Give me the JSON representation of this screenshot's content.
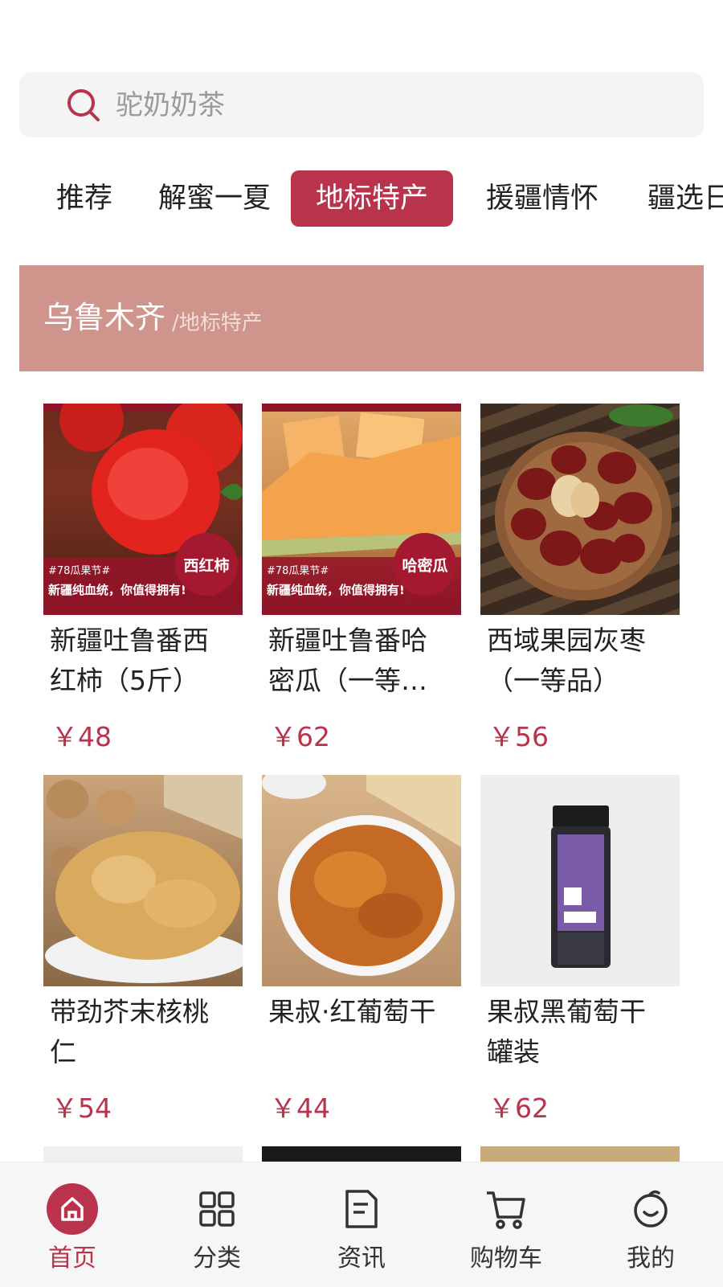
{
  "search": {
    "placeholder": "驼奶奶茶"
  },
  "tabs": [
    {
      "label": "推荐",
      "active": false
    },
    {
      "label": "解蜜一夏",
      "active": false
    },
    {
      "label": "地标特产",
      "active": true
    },
    {
      "label": "援疆情怀",
      "active": false
    },
    {
      "label": "疆选日",
      "active": false
    }
  ],
  "banner": {
    "title": "乌鲁木齐",
    "subtitle": "/地标特产"
  },
  "products": [
    {
      "title": "新疆吐鲁番西红柿（5斤）",
      "price": "￥48",
      "badge": "西红柿",
      "promo_tag": "#78瓜果节#",
      "promo_text": "新疆纯血统，你值得拥有!"
    },
    {
      "title": "新疆吐鲁番哈密瓜（一等…",
      "price": "￥62",
      "badge": "哈密瓜",
      "promo_tag": "#78瓜果节#",
      "promo_text": "新疆纯血统，你值得拥有!"
    },
    {
      "title": "西域果园灰枣（一等品）",
      "price": "￥56"
    },
    {
      "title": "带劲芥末核桃仁",
      "price": "￥54"
    },
    {
      "title": "果叔·红葡萄干",
      "price": "￥44"
    },
    {
      "title": "果叔黑葡萄干罐装",
      "price": "￥62"
    }
  ],
  "bottom_nav": [
    {
      "label": "首页",
      "icon": "home-icon",
      "active": true
    },
    {
      "label": "分类",
      "icon": "grid-icon",
      "active": false
    },
    {
      "label": "资讯",
      "icon": "news-icon",
      "active": false
    },
    {
      "label": "购物车",
      "icon": "cart-icon",
      "active": false
    },
    {
      "label": "我的",
      "icon": "profile-icon",
      "active": false
    }
  ],
  "colors": {
    "accent": "#b8334b",
    "banner": "#cf948c"
  }
}
